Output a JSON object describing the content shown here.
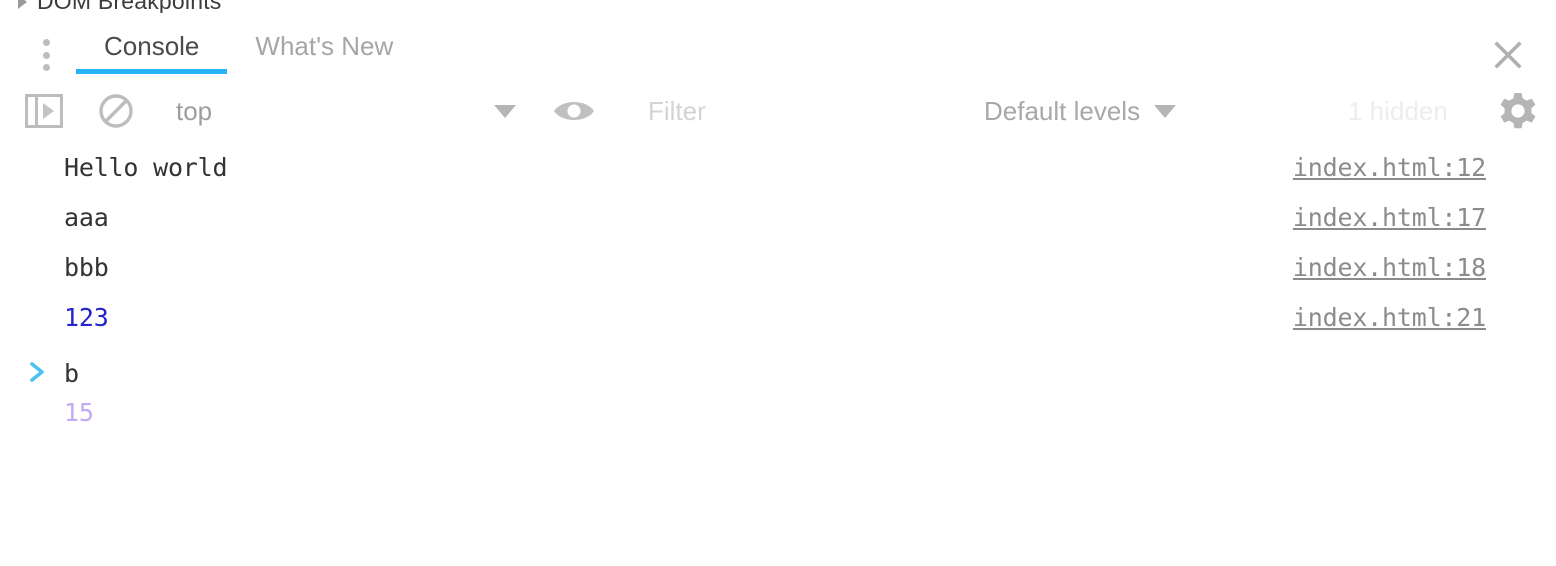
{
  "clipped_panel": {
    "title": "DOM Breakpoints",
    "arrow_icon": "chevron-right-icon"
  },
  "tabstrip": {
    "more_icon": "more-vertical-icon",
    "close_icon": "close-icon",
    "active_underline_color": "#29b3f4",
    "tabs": [
      {
        "label": "Console",
        "active": true
      },
      {
        "label": "What's New",
        "active": false
      }
    ]
  },
  "toolbar": {
    "sidebar_toggle_icon": "sidebar-toggle-icon",
    "clear_console_icon": "clear-console-icon",
    "context_value": "top",
    "context_caret_icon": "chevron-down-icon",
    "eye_icon": "eye-icon",
    "filter_placeholder": "Filter",
    "filter_value": "",
    "levels_value": "Default levels",
    "levels_caret_icon": "chevron-down-icon",
    "hidden_count": "1 hidden",
    "settings_icon": "gear-icon"
  },
  "console": {
    "messages": [
      {
        "text": "Hello world",
        "kind": "log",
        "source": "index.html:12"
      },
      {
        "text": "aaa",
        "kind": "log",
        "source": "index.html:17"
      },
      {
        "text": "bbb",
        "kind": "log",
        "source": "index.html:18"
      },
      {
        "text": "123",
        "kind": "number",
        "source": "index.html:21"
      }
    ],
    "prompt": {
      "chevron_icon": "prompt-chevron-icon",
      "input_value": "b",
      "eval_hint": "15"
    }
  },
  "colors": {
    "accent": "#29b3f4",
    "log_text": "#333333",
    "number_text": "#2424cf",
    "source_link": "#8b8b8b",
    "eval_hint": "#c2aaf7",
    "muted": "#a8a8a8"
  }
}
